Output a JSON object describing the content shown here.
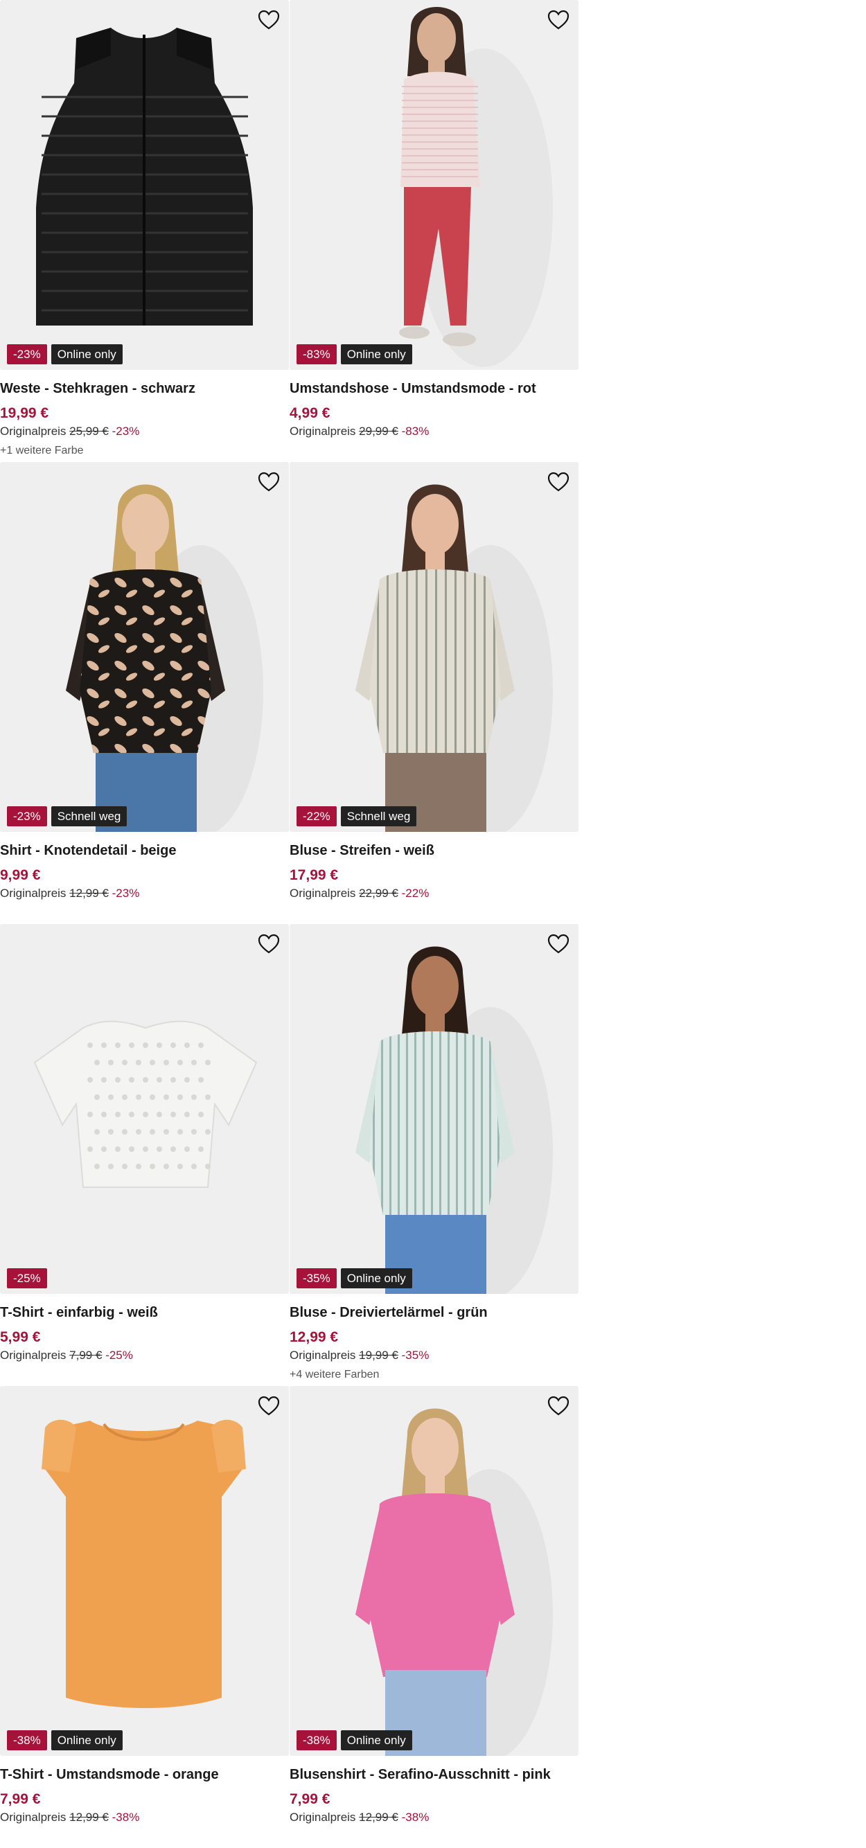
{
  "labels": {
    "original_price": "Originalpreis"
  },
  "colors": {
    "accent": "#a6123a",
    "badge_dark": "#222222",
    "image_bg": "#efefef"
  },
  "products": [
    {
      "title": "Weste - Stehkragen - schwarz",
      "price": "19,99 €",
      "original_price": "25,99 €",
      "discount": "-23%",
      "badge": "Online only",
      "more_colors": "+1 weitere Farbe",
      "image": "black-puffer-vest"
    },
    {
      "title": "Umstandshose - Umstandsmode - rot",
      "price": "4,99 €",
      "original_price": "29,99 €",
      "discount": "-83%",
      "badge": "Online only",
      "more_colors": "",
      "image": "model-red-maternity-trousers"
    },
    {
      "title": "Shirt - Knotendetail - beige",
      "price": "9,99 €",
      "original_price": "12,99 €",
      "discount": "-23%",
      "badge": "Schnell weg",
      "more_colors": "",
      "image": "model-leaf-print-shirt"
    },
    {
      "title": "Bluse - Streifen - weiß",
      "price": "17,99 €",
      "original_price": "22,99 €",
      "discount": "-22%",
      "badge": "Schnell weg",
      "more_colors": "",
      "image": "model-striped-blouse"
    },
    {
      "title": "T-Shirt - einfarbig - weiß",
      "price": "5,99 €",
      "original_price": "7,99 €",
      "discount": "-25%",
      "badge": "",
      "more_colors": "",
      "image": "white-lace-tshirt"
    },
    {
      "title": "Bluse - Dreiviertelärmel - grün",
      "price": "12,99 €",
      "original_price": "19,99 €",
      "discount": "-35%",
      "badge": "Online only",
      "more_colors": "+4 weitere Farben",
      "image": "model-green-striped-blouse"
    },
    {
      "title": "T-Shirt - Umstandsmode - orange",
      "price": "7,99 €",
      "original_price": "12,99 €",
      "discount": "-38%",
      "badge": "Online only",
      "more_colors": "",
      "image": "orange-ruffle-tshirt"
    },
    {
      "title": "Blusenshirt - Serafino-Ausschnitt - pink",
      "price": "7,99 €",
      "original_price": "12,99 €",
      "discount": "-38%",
      "badge": "Online only",
      "more_colors": "",
      "image": "model-pink-blouse"
    }
  ]
}
